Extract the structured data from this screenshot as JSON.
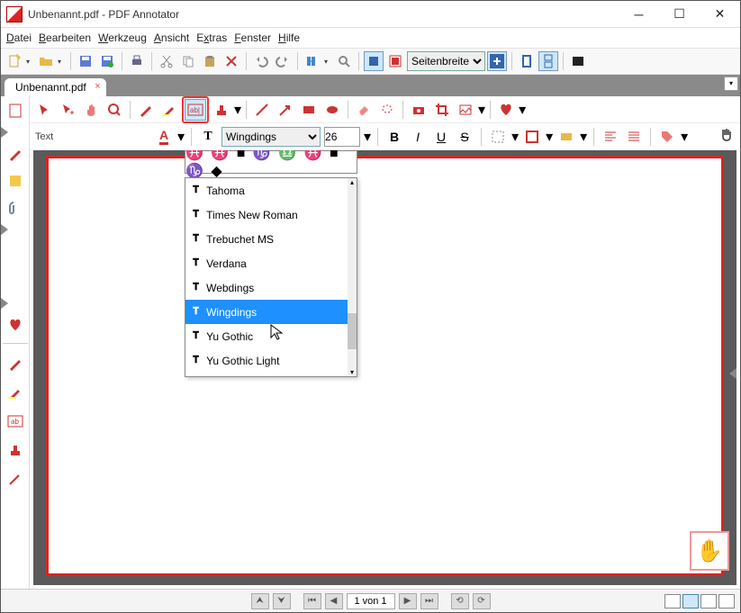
{
  "titlebar": {
    "title": "Unbenannt.pdf - PDF Annotator"
  },
  "menu": {
    "file": "Datei",
    "edit": "Bearbeiten",
    "tool": "Werkzeug",
    "view": "Ansicht",
    "extras": "Extras",
    "window": "Fenster",
    "help": "Hilfe"
  },
  "toolbar1": {
    "zoom_mode": "Seitenbreite"
  },
  "tab": {
    "name": "Unbenannt.pdf"
  },
  "textrow": {
    "label": "Text",
    "font": "Wingdings",
    "size": "26"
  },
  "fontlist": {
    "preview": "♓ ♓ ■ ♑ ♎ ♓ ■ ♑ ◆",
    "items": [
      "Tahoma",
      "Times New Roman",
      "Trebuchet MS",
      "Verdana",
      "Webdings",
      "Wingdings",
      "Yu Gothic",
      "Yu Gothic Light"
    ],
    "selected_index": 5
  },
  "status": {
    "page": "1 von 1"
  }
}
